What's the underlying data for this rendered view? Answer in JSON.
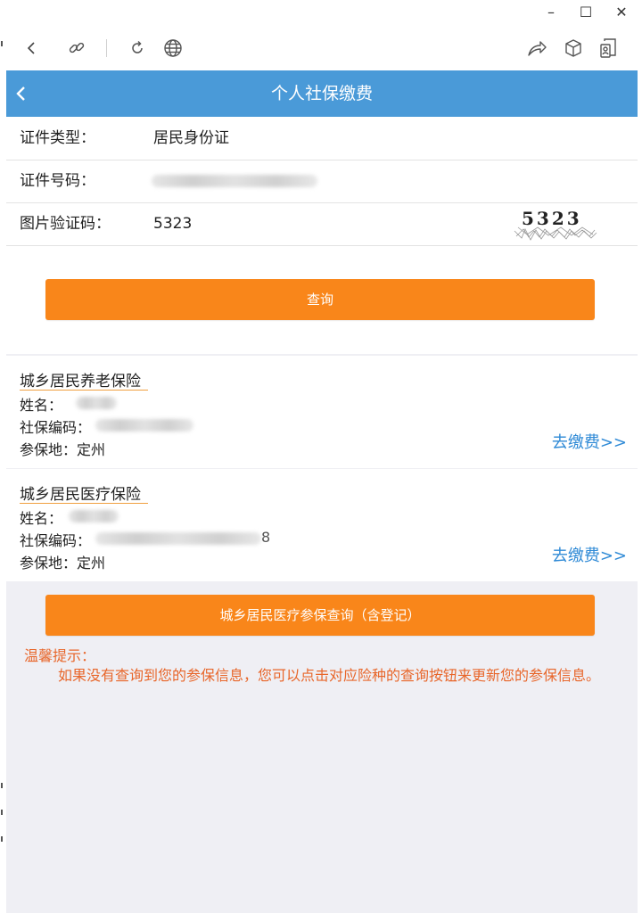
{
  "window": {
    "controls": {
      "minimize": "–",
      "maximize": "☐",
      "close": "✕"
    }
  },
  "toolbar": {
    "icons": [
      "back-icon",
      "link-icon",
      "refresh-icon",
      "globe-icon",
      "share-icon",
      "cube-icon",
      "profile-icon"
    ]
  },
  "header": {
    "title": "个人社保缴费",
    "back": "<"
  },
  "form": {
    "id_type": {
      "label": "证件类型：",
      "value": "居民身份证"
    },
    "id_number": {
      "label": "证件号码："
    },
    "captcha": {
      "label": "图片验证码：",
      "value": "5323",
      "image_text": "5323"
    },
    "query_button": "查询"
  },
  "insurances": [
    {
      "title": "城乡居民养老保险",
      "name_label": "姓名：",
      "code_label": "社保编码：",
      "place_label": "参保地：",
      "place": "定州",
      "pay_link": "去缴费>>"
    },
    {
      "title": "城乡居民医疗保险",
      "name_label": "姓名：",
      "code_label": "社保编码：",
      "code_suffix": "8",
      "place_label": "参保地：",
      "place": "定州",
      "pay_link": "去缴费>>"
    }
  ],
  "medical_query_button": "城乡居民医疗参保查询（含登记）",
  "tip": {
    "title": "温馨提示：",
    "body": "如果没有查询到您的参保信息，您可以点击对应险种的查询按钮来更新您的参保信息。"
  },
  "colors": {
    "header_bg": "#4a9ad8",
    "button_bg": "#f9861a",
    "link": "#2f8ad6",
    "tip_text": "#e8662a",
    "page_bg": "#efeff4"
  }
}
